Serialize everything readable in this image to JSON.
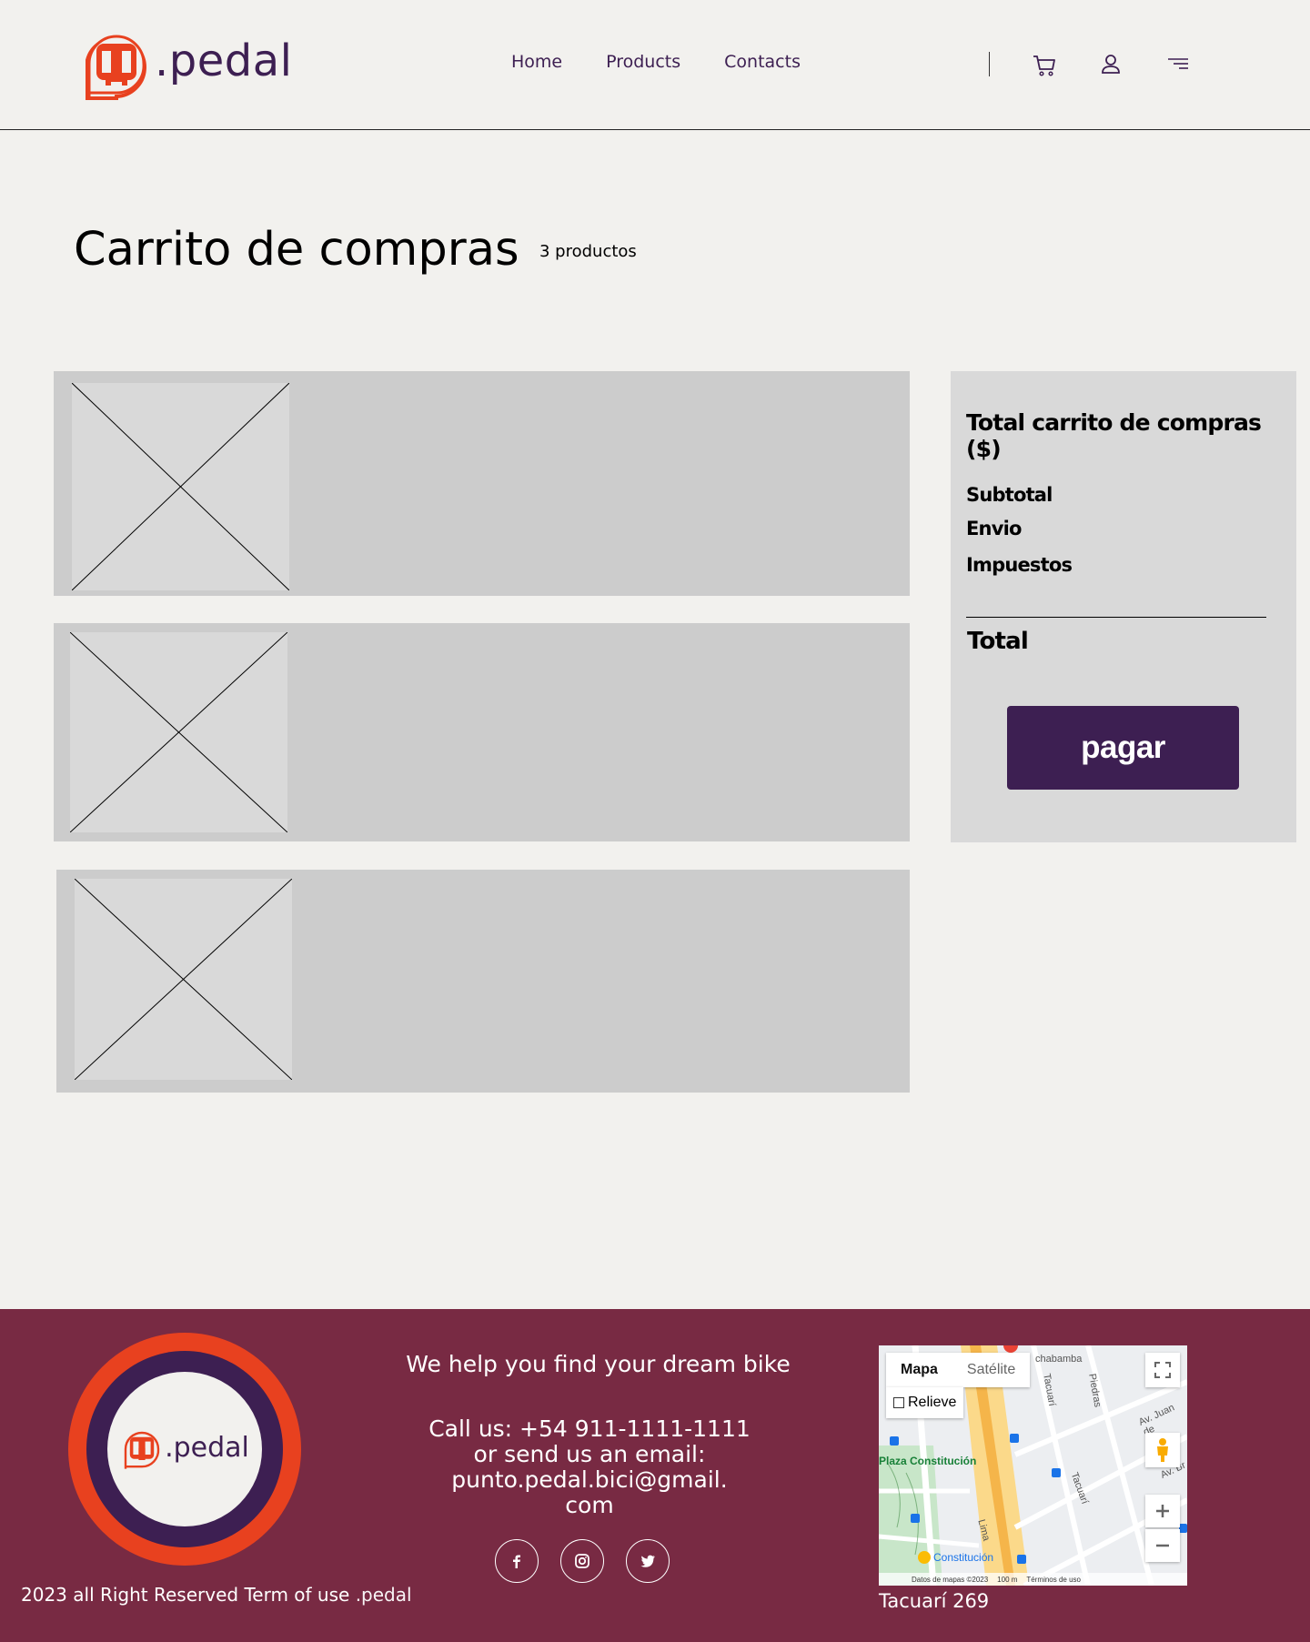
{
  "brand": {
    "name": ".pedal",
    "color_primary": "#3d1f52",
    "color_accent": "#e8411f",
    "footer_bg": "#782a43"
  },
  "nav": {
    "items": [
      "Home",
      "Products",
      "Contacts"
    ]
  },
  "header_icons": [
    "cart-icon",
    "user-icon",
    "menu-icon"
  ],
  "cart": {
    "title": "Carrito de compras",
    "count_label": "3 productos",
    "items": [
      {
        "image": "image-placeholder"
      },
      {
        "image": "image-placeholder"
      },
      {
        "image": "image-placeholder"
      }
    ]
  },
  "summary": {
    "title": "Total carrito de compras ($)",
    "subtotal_label": "Subtotal",
    "shipping_label": "Envio",
    "taxes_label": "Impuestos",
    "total_label": "Total",
    "pay_label": "pagar"
  },
  "footer": {
    "tagline": "We help you find your dream bike",
    "contact_lines": [
      "Call us:  +54 911-1111-1111",
      "or send us an email:",
      "punto.pedal.bici@gmail.",
      "com"
    ],
    "copyright": "2023 all Right Reserved Term of use",
    "copyright_brand": ".pedal",
    "social": [
      "facebook-icon",
      "instagram-icon",
      "twitter-icon"
    ],
    "address": "Tacuarí 269",
    "map": {
      "tab_map": "Mapa",
      "tab_satellite": "Satélite",
      "relief": "Relieve",
      "labels": {
        "plaza": "Plaza Constitución",
        "station": "Constitución",
        "chabamba": "chabamba",
        "piedras": "Piedras",
        "tacuari1": "Tacuarí",
        "tacuari2": "Tacuarí",
        "lima": "Lima",
        "juande": "Av. Juan de",
        "avbr": "Av. Br"
      },
      "attribution": [
        "Datos de mapas ©2023",
        "100 m",
        "Términos de uso"
      ]
    }
  }
}
